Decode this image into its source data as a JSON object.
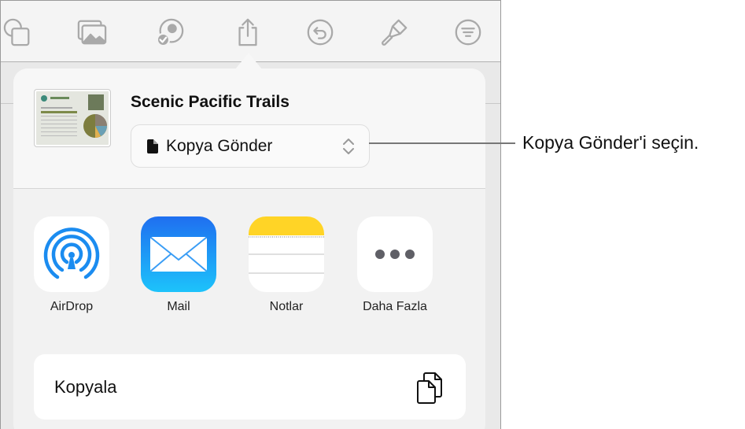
{
  "toolbar": {
    "icons": [
      "shapes-icon",
      "media-icon",
      "collaborate-icon",
      "share-icon",
      "undo-icon",
      "format-brush-icon",
      "more-menu-icon"
    ]
  },
  "share_sheet": {
    "document_title": "Scenic Pacific Trails",
    "send_option": "Kopya Gönder",
    "apps": [
      {
        "label": "AirDrop",
        "icon": "airdrop-icon"
      },
      {
        "label": "Mail",
        "icon": "mail-icon"
      },
      {
        "label": "Notlar",
        "icon": "notes-icon"
      },
      {
        "label": "Daha Fazla",
        "icon": "more-icon"
      }
    ],
    "copy_label": "Kopyala"
  },
  "callout": "Kopya Gönder'i seçin.",
  "colors": {
    "mail_blue": "#1e90f5",
    "airdrop_blue": "#1b8cf0",
    "notes_yellow": "#ffd426"
  }
}
